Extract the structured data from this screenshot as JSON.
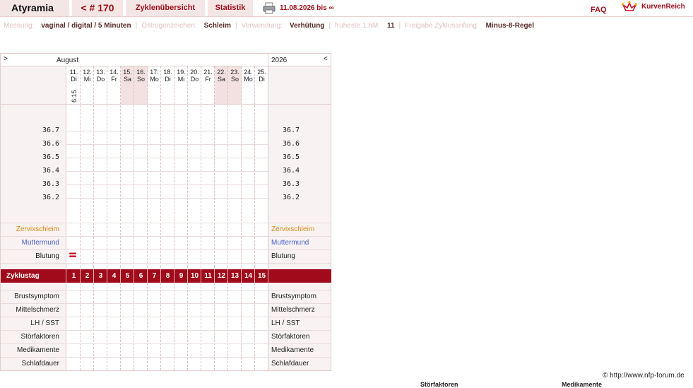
{
  "topbar": {
    "name": "Atyramia",
    "cycle_number": "< # 170",
    "overview_tab": "Zyklenübersicht",
    "stats_tab": "Statistik",
    "date_range": "11.08.2026 bis ∞",
    "faq": "FAQ",
    "brand": "KurvenReich"
  },
  "info": {
    "measurement_label": "Messung:",
    "measurement_value": "vaginal / digital / 5 Minuten",
    "estrogen_label": "Östrogenzeichen:",
    "estrogen_value": "Schleim",
    "usage_label": "Verwendung:",
    "usage_value": "Verhütung",
    "earliest_label": "früheste 1.hM:",
    "earliest_value": "11",
    "release_label": "Freigabe Zyklusanfang:",
    "release_value": "Minus-8-Regel"
  },
  "chart": {
    "nav_prev": ">",
    "nav_next": "<",
    "month": "August",
    "year": "2026",
    "days": [
      {
        "date": "11.",
        "weekday": "Di",
        "weekend": false
      },
      {
        "date": "12.",
        "weekday": "Mi",
        "weekend": false
      },
      {
        "date": "13.",
        "weekday": "Do",
        "weekend": false
      },
      {
        "date": "14.",
        "weekday": "Fr",
        "weekend": false
      },
      {
        "date": "15.",
        "weekday": "Sa",
        "weekend": true
      },
      {
        "date": "16.",
        "weekday": "So",
        "weekend": true
      },
      {
        "date": "17.",
        "weekday": "Mo",
        "weekend": false
      },
      {
        "date": "18.",
        "weekday": "Di",
        "weekend": false
      },
      {
        "date": "19.",
        "weekday": "Mi",
        "weekend": false
      },
      {
        "date": "20.",
        "weekday": "Do",
        "weekend": false
      },
      {
        "date": "21.",
        "weekday": "Fr",
        "weekend": false
      },
      {
        "date": "22.",
        "weekday": "Sa",
        "weekend": true
      },
      {
        "date": "23.",
        "weekday": "So",
        "weekend": true
      },
      {
        "date": "24.",
        "weekday": "Mo",
        "weekend": false
      },
      {
        "date": "25.",
        "weekday": "Di",
        "weekend": false
      }
    ],
    "first_day_time": "6:15",
    "temperatures": [
      "36.7",
      "36.6",
      "36.5",
      "36.4",
      "36.3",
      "36.2"
    ],
    "rows": {
      "cervical_mucus": "Zervixschleim",
      "cervix": "Muttermund",
      "bleeding": "Blutung",
      "cycle_day": "Zyklustag",
      "breast": "Brustsymptom",
      "midpain": "Mittelschmerz",
      "lh": "LH / SST",
      "disturb": "Störfaktoren",
      "meds": "Medikamente",
      "sleep": "Schlafdauer"
    },
    "cycle_days": [
      "1",
      "2",
      "3",
      "4",
      "5",
      "6",
      "7",
      "8",
      "9",
      "10",
      "11",
      "12",
      "13",
      "14",
      "15"
    ],
    "bleeding_day_index": 0
  },
  "footer": {
    "copyright": "© http://www.nfp-forum.de",
    "legend_disturb": "Störfaktoren",
    "legend_meds": "Medikamente"
  },
  "colors": {
    "accent": "#a0101a",
    "zyklustag_bar": "#a00a1a",
    "mucus": "#e08a14",
    "cervix": "#4a62c8"
  }
}
